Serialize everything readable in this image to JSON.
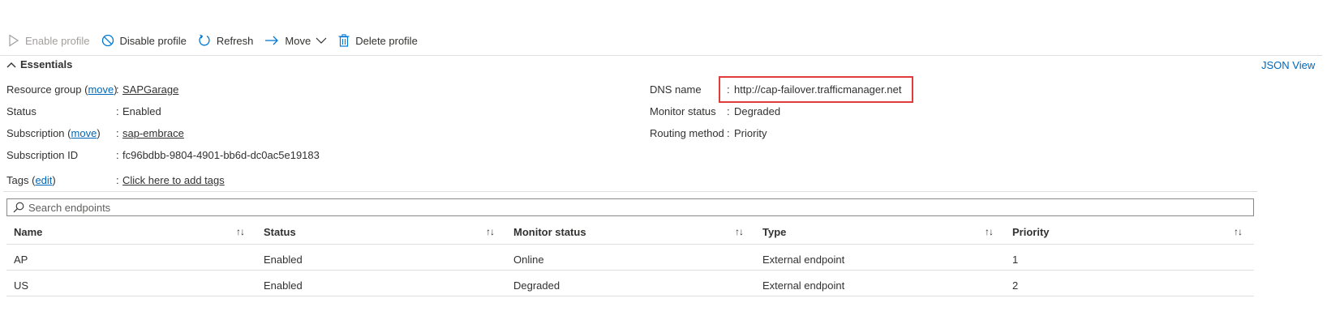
{
  "toolbar": {
    "enable_profile": "Enable profile",
    "disable_profile": "Disable profile",
    "refresh": "Refresh",
    "move": "Move",
    "delete_profile": "Delete profile"
  },
  "essentials": {
    "title": "Essentials",
    "json_view": "JSON View",
    "left": {
      "resource_group": {
        "label": "Resource group",
        "action": "move",
        "value": "SAPGarage"
      },
      "status": {
        "label": "Status",
        "value": "Enabled"
      },
      "subscription": {
        "label": "Subscription",
        "action": "move",
        "value": "sap-embrace"
      },
      "subscription_id": {
        "label": "Subscription ID",
        "value": "fc96bdbb-9804-4901-bb6d-dc0ac5e19183"
      },
      "tags": {
        "label": "Tags",
        "action": "edit",
        "value": "Click here to add tags"
      }
    },
    "right": {
      "dns_name": {
        "label": "DNS name",
        "value": "http://cap-failover.trafficmanager.net"
      },
      "monitor_status": {
        "label": "Monitor status",
        "value": "Degraded"
      },
      "routing_method": {
        "label": "Routing method",
        "value": "Priority"
      }
    }
  },
  "search": {
    "placeholder": "Search endpoints"
  },
  "table": {
    "columns": [
      "Name",
      "Status",
      "Monitor status",
      "Type",
      "Priority"
    ],
    "sort_glyph": "↑↓",
    "rows": [
      [
        "AP",
        "Enabled",
        "Online",
        "External endpoint",
        "1"
      ],
      [
        "US",
        "Enabled",
        "Degraded",
        "External endpoint",
        "2"
      ]
    ]
  },
  "colors": {
    "link": "#0067b8",
    "highlight_border": "#e03c3c",
    "divider": "#e1dfdd"
  }
}
